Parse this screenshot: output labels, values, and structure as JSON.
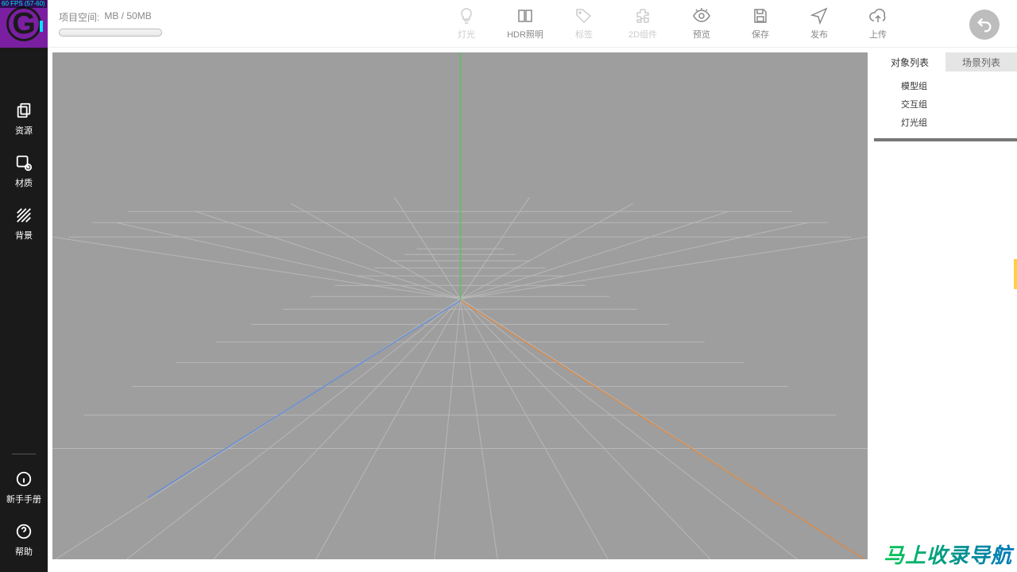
{
  "fps": "60 FPS (57-60)",
  "sidebar": {
    "items": [
      {
        "label": "资源"
      },
      {
        "label": "材质"
      },
      {
        "label": "背景"
      }
    ],
    "bottom": [
      {
        "label": "新手手册"
      },
      {
        "label": "帮助"
      }
    ]
  },
  "project": {
    "label": "项目空间:",
    "value": "MB / 50MB"
  },
  "toolbar": {
    "items": [
      {
        "label": "灯光",
        "disabled": true
      },
      {
        "label": "HDR照明",
        "disabled": false
      },
      {
        "label": "标签",
        "disabled": true
      },
      {
        "label": "2D组件",
        "disabled": true
      },
      {
        "label": "预览",
        "disabled": false
      },
      {
        "label": "保存",
        "disabled": false
      },
      {
        "label": "发布",
        "disabled": false
      },
      {
        "label": "上传",
        "disabled": false
      }
    ]
  },
  "panel": {
    "tabs": [
      {
        "label": "对象列表",
        "active": true
      },
      {
        "label": "场景列表",
        "active": false
      }
    ],
    "tree": [
      {
        "label": "模型组"
      },
      {
        "label": "交互组"
      },
      {
        "label": "灯光组"
      }
    ]
  },
  "watermark": "马上收录导航",
  "colors": {
    "sidebar_bg": "#1a1a1a",
    "logo_bg": "#7b1fa2",
    "accent_cyan": "#00e5ff",
    "viewport_bg": "#9e9e9e",
    "axis_x": "#d88a4a",
    "axis_y": "#5fbf5f",
    "axis_z": "#6a8fd6",
    "handle": "#ffcf3f"
  }
}
